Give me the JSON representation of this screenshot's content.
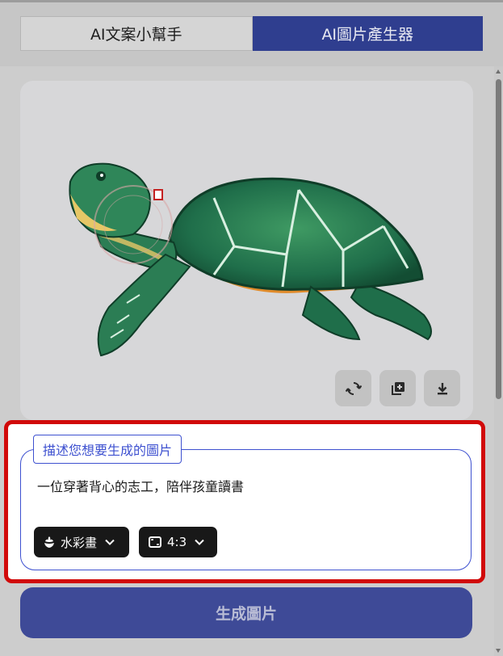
{
  "tabs": [
    {
      "label": "AI文案小幫手",
      "active": false
    },
    {
      "label": "AI圖片產生器",
      "active": true
    }
  ],
  "image_actions": {
    "regenerate_icon": "refresh-icon",
    "add_icon": "add-to-library-icon",
    "download_icon": "download-icon"
  },
  "prompt": {
    "legend": "描述您想要生成的圖片",
    "value": "一位穿著背心的志工，陪伴孩童讀書"
  },
  "style_select": {
    "icon": "style-flower-icon",
    "value": "水彩畫"
  },
  "ratio_select": {
    "icon": "aspect-ratio-icon",
    "value": "4:3"
  },
  "generate_button": {
    "label": "生成圖片"
  },
  "colors": {
    "accent": "#2f3e8f",
    "highlight": "#d10a0a",
    "prompt_border": "#3e51d0"
  }
}
